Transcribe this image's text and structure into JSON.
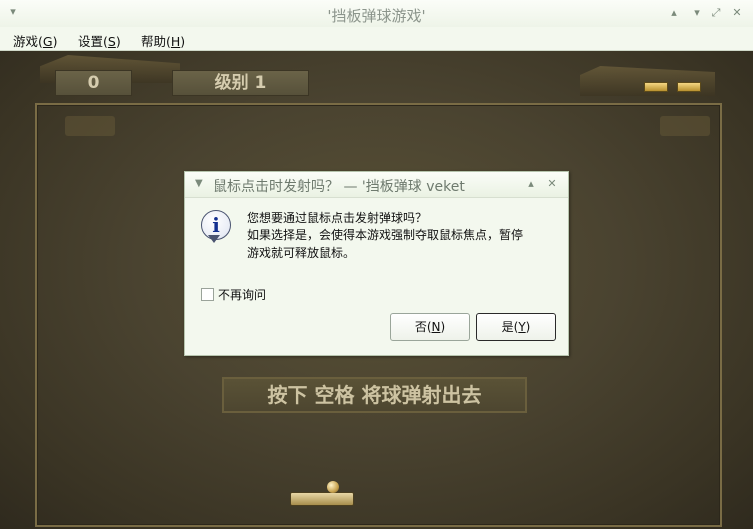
{
  "window": {
    "title": "'挡板弹球游戏'",
    "menu_icon": "chevron-down-icon",
    "controls": [
      "chevron-up-icon",
      "chevron-down-icon",
      "maximize-icon",
      "close-icon"
    ]
  },
  "menubar": {
    "items": [
      {
        "prefix": "游戏(",
        "mnemonic": "G",
        "suffix": ")"
      },
      {
        "prefix": "设置(",
        "mnemonic": "S",
        "suffix": ")"
      },
      {
        "prefix": "帮助(",
        "mnemonic": "H",
        "suffix": ")"
      }
    ]
  },
  "game": {
    "score": "0",
    "level": "级别 1",
    "lives": 2,
    "prompt": "按下 空格 将球弹射出去"
  },
  "dialog": {
    "title": "鼠标点击时发射吗？ — '挡板弹球 veket",
    "icon": "info-icon",
    "message_line1": "您想要通过鼠标点击发射弹球吗？",
    "message_line2": "如果选择是，会使得本游戏强制夺取鼠标焦点，暂停",
    "message_line3": "游戏就可释放鼠标。",
    "checkbox_label": "不再询问",
    "checkbox_checked": false,
    "no_button": {
      "prefix": "否(",
      "mnemonic": "N",
      "suffix": ")"
    },
    "yes_button": {
      "prefix": "是(",
      "mnemonic": "Y",
      "suffix": ")"
    }
  }
}
